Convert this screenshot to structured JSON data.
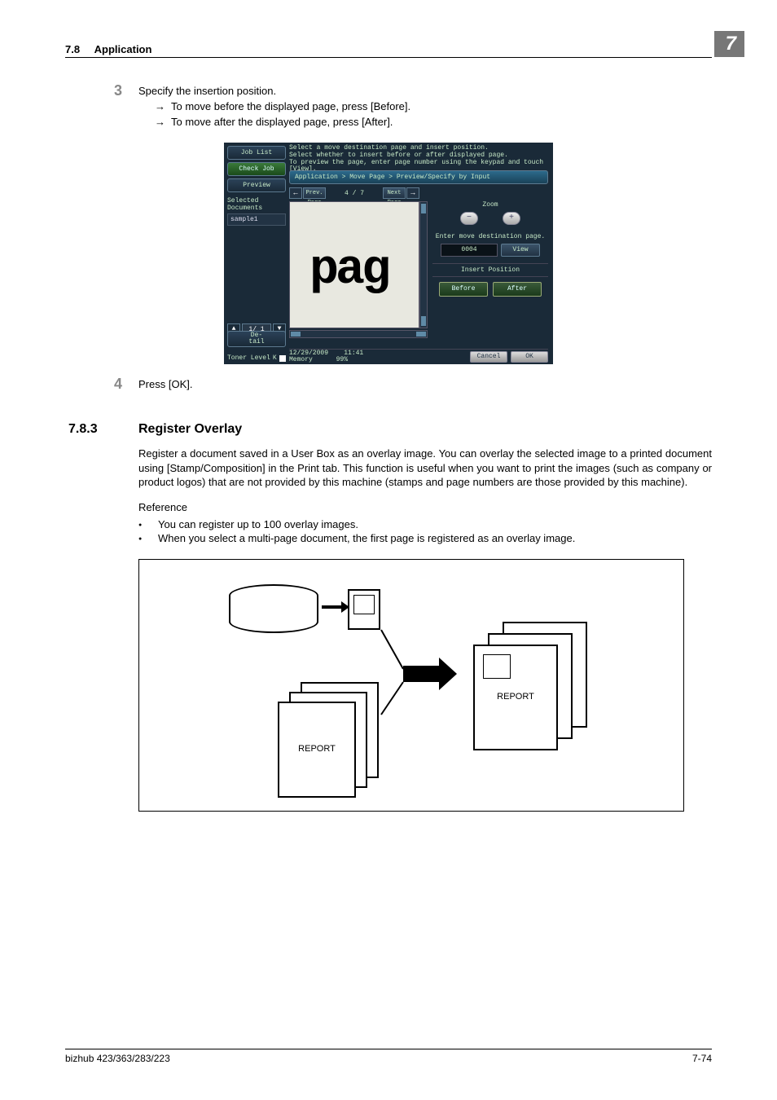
{
  "header": {
    "section_num": "7.8",
    "section_title": "Application",
    "chapter": "7"
  },
  "step3": {
    "num": "3",
    "text": "Specify the insertion position.",
    "bullets": [
      "To move before the displayed page, press [Before].",
      "To move after the displayed page, press [After]."
    ]
  },
  "panel": {
    "job_list": "Job List",
    "check_job": "Check Job",
    "preview": "Preview",
    "selected_docs_label": "Selected Documents",
    "doc_name": "sample1",
    "pager_text": "1/  1",
    "detail": "De-\ntail",
    "toner_label": "Toner Level",
    "toner_letter": "K",
    "instructions": "Select a move destination page and insert position.\nSelect whether to insert before or after displayed page.\nTo preview the page, enter page number using the keypad and touch [View].",
    "breadcrumb": "Application > Move Page > Preview/Specify by Input",
    "prev_page": "Prev.\nPage",
    "next_page": "Next\nPage",
    "page_indicator": "4 /    7",
    "preview_big_text": "pag",
    "zoom_label": "Zoom",
    "enter_label": "Enter move destination page.",
    "dest_value": "0004",
    "view": "View",
    "insert_position_label": "Insert Position",
    "before": "Before",
    "after": "After",
    "date": "12/29/2009",
    "time": "11:41",
    "memory_label": "Memory",
    "memory_value": "99%",
    "cancel": "Cancel",
    "ok": "OK"
  },
  "step4": {
    "num": "4",
    "text": "Press [OK]."
  },
  "section": {
    "num": "7.8.3",
    "title": "Register Overlay",
    "para": "Register a document saved in a User Box as an overlay image. You can overlay the selected image to a printed document using [Stamp/Composition] in the Print tab. This function is useful when you want to print the images (such as company or product logos) that are not provided by this machine (stamps and page numbers are those provided by this machine).",
    "ref_label": "Reference",
    "bullets": [
      "You can register up to 100 overlay images.",
      "When you select a multi-page document, the first page is registered as an overlay image."
    ]
  },
  "diagram": {
    "report": "REPORT"
  },
  "footer": {
    "left": "bizhub 423/363/283/223",
    "right": "7-74"
  }
}
